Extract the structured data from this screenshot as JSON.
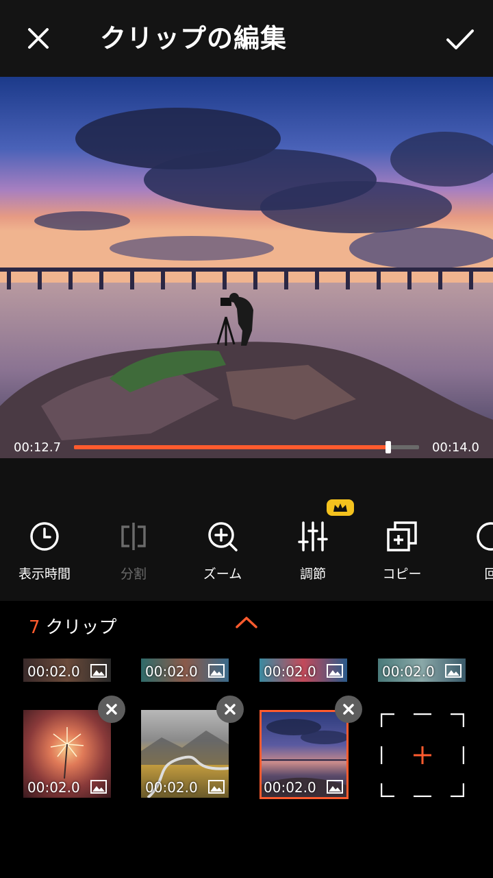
{
  "header": {
    "title": "クリップの編集",
    "close_icon": "close-icon",
    "confirm_icon": "check-icon"
  },
  "player": {
    "current_time": "00:12.7",
    "total_time": "00:14.0",
    "progress": 0.91
  },
  "tools": [
    {
      "label": "表示時間",
      "icon": "clock-icon",
      "enabled": true
    },
    {
      "label": "分割",
      "icon": "split-icon",
      "enabled": false
    },
    {
      "label": "ズーム",
      "icon": "zoom-icon",
      "enabled": true
    },
    {
      "label": "調節",
      "icon": "sliders-icon",
      "enabled": true,
      "premium": true
    },
    {
      "label": "コピー",
      "icon": "copy-icon",
      "enabled": true
    },
    {
      "label": "回",
      "icon": "rotate-icon",
      "enabled": true
    }
  ],
  "clips": {
    "count": "7",
    "count_label": "クリップ",
    "items": [
      {
        "duration": "00:02.0",
        "type": "image"
      },
      {
        "duration": "00:02.0",
        "type": "image"
      },
      {
        "duration": "00:02.0",
        "type": "image"
      },
      {
        "duration": "00:02.0",
        "type": "image"
      },
      {
        "duration": "00:02.0",
        "type": "image"
      },
      {
        "duration": "00:02.0",
        "type": "image"
      },
      {
        "duration": "00:02.0",
        "type": "image",
        "selected": true
      }
    ]
  },
  "colors": {
    "accent": "#ff5b2e",
    "premium": "#f4c21e",
    "background": "#111111"
  }
}
